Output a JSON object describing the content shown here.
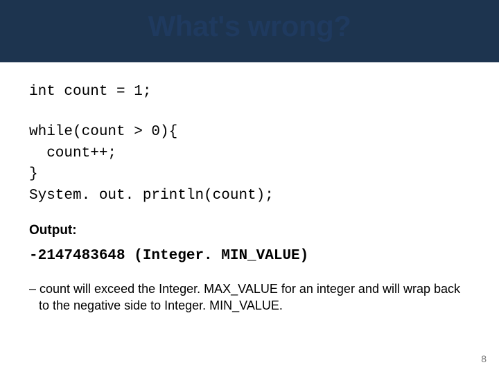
{
  "title": "What's wrong?",
  "code": {
    "line1": "int count = 1;",
    "line2": "while(count > 0){",
    "line3": "  count++;",
    "line4": "}",
    "line5": "System. out. println(count);"
  },
  "output_label": "Output:",
  "output_value": "-2147483648 (Integer. MIN_VALUE)",
  "explanation": "– count will exceed the Integer. MAX_VALUE for an integer and will wrap back to the negative side to Integer. MIN_VALUE.",
  "page_number": "8"
}
